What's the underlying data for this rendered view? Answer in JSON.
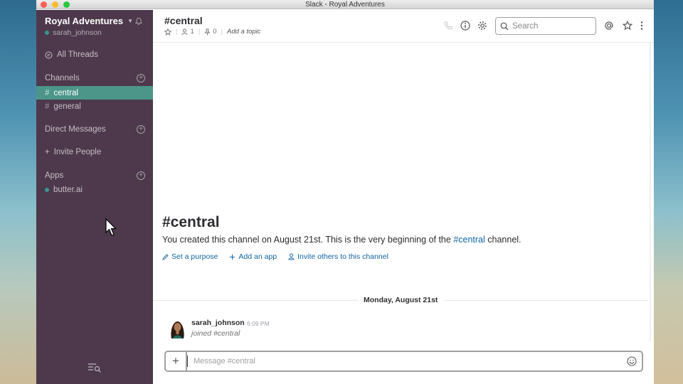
{
  "window": {
    "title": "Slack - Royal Adventures"
  },
  "sidebar": {
    "team_name": "Royal Adventures",
    "user_name": "sarah_johnson",
    "all_threads": "All Threads",
    "channels_header": "Channels",
    "channels": [
      {
        "hash": "#",
        "name": "central",
        "active": true
      },
      {
        "hash": "#",
        "name": "general",
        "active": false
      }
    ],
    "dm_header": "Direct Messages",
    "invite_label": "Invite People",
    "invite_plus": "+",
    "apps_header": "Apps",
    "apps": [
      {
        "name": "butter.ai"
      }
    ],
    "add_symbol": "+"
  },
  "header": {
    "channel_title": "#central",
    "members_count": "1",
    "pins_count": "0",
    "add_topic": "Add a topic",
    "separator": "|",
    "search_placeholder": "Search"
  },
  "intro": {
    "title": "#central",
    "text_before": "You created this channel on August 21st. This is the very beginning of the ",
    "channel_link": "#central",
    "text_after": " channel.",
    "actions": [
      {
        "label": "Set a purpose",
        "icon": "pencil-icon"
      },
      {
        "label": "Add an app",
        "icon": "plus-icon"
      },
      {
        "label": "Invite others to this channel",
        "icon": "user-icon"
      }
    ]
  },
  "messages": {
    "day_label": "Monday, August 21st",
    "items": [
      {
        "author": "sarah_johnson",
        "time": "6:09 PM",
        "body": "joined #central"
      }
    ]
  },
  "composer": {
    "plus": "+",
    "placeholder": "Message #central"
  },
  "colors": {
    "sidebar_bg": "#4d394b",
    "active_channel": "#4c9689",
    "link": "#1264a3",
    "presence": "#38978d"
  }
}
